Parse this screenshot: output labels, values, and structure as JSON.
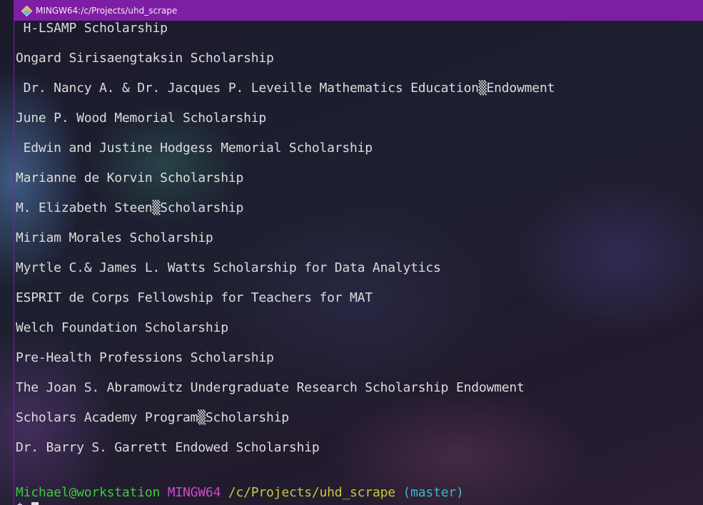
{
  "window": {
    "title": "MINGW64:/c/Projects/uhd_scrape"
  },
  "output_lines": [
    " H-LSAMP Scholarship",
    "Ongard Sirisaengtaksin Scholarship",
    " Dr. Nancy A. & Dr. Jacques P. Leveille Mathematics Education▒Endowment",
    "June P. Wood Memorial Scholarship",
    " Edwin and Justine Hodgess Memorial Scholarship",
    "Marianne de Korvin Scholarship",
    "M. Elizabeth Steen▒Scholarship",
    "Miriam Morales Scholarship",
    "Myrtle C.& James L. Watts Scholarship for Data Analytics",
    "ESPRIT de Corps Fellowship for Teachers for MAT",
    "Welch Foundation Scholarship",
    "Pre-Health Professions Scholarship",
    "The Joan S. Abramowitz Undergraduate Research Scholarship Endowment",
    "Scholars Academy Program▒Scholarship",
    "Dr. Barry S. Garrett Endowed Scholarship"
  ],
  "prompt": {
    "user_host": "Michael@workstation",
    "system": "MINGW64",
    "path": "/c/Projects/uhd_scrape",
    "branch": "(master)",
    "symbol": "$"
  },
  "colors": {
    "titlebar": "#7e1fa3",
    "text": "#dcdcdc",
    "user_host": "#3ec93e",
    "system": "#c94cc9",
    "path": "#c8c83a",
    "branch": "#3ab8c8"
  }
}
